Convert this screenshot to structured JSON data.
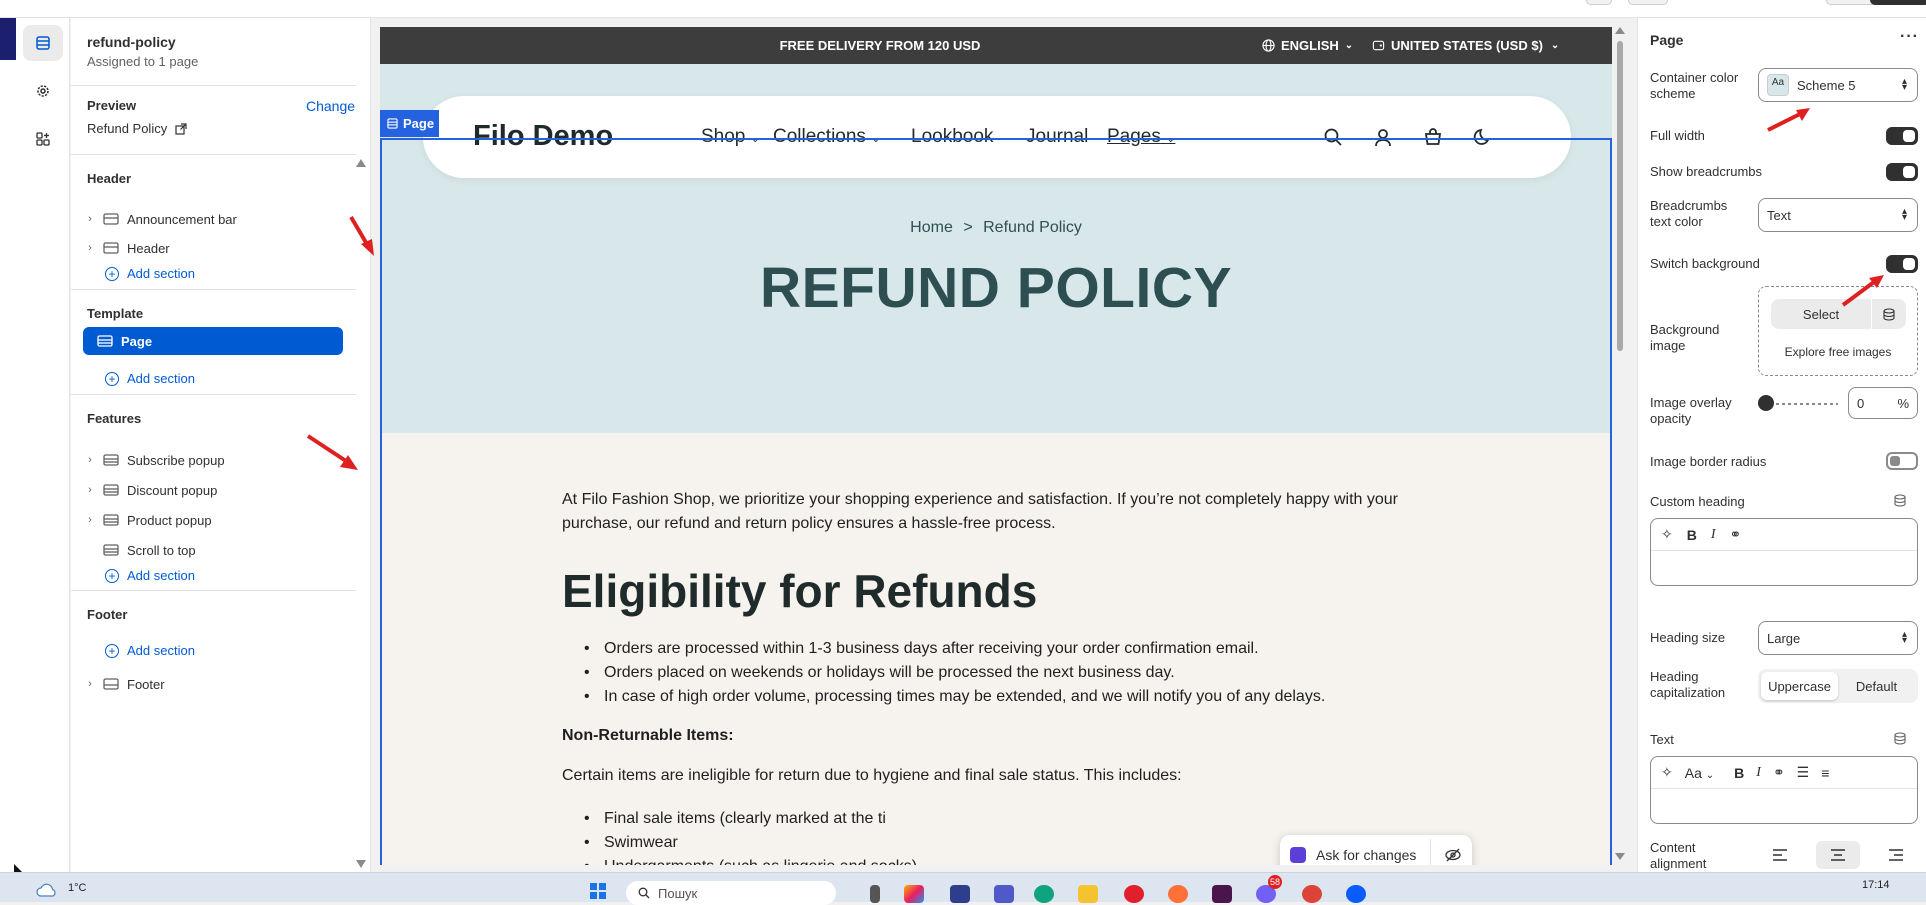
{
  "sidebar": {
    "title": "refund-policy",
    "subtitle": "Assigned to 1 page",
    "preview_label": "Preview",
    "change_label": "Change",
    "preview_page": "Refund Policy",
    "groups": {
      "header": {
        "label": "Header",
        "items": [
          "Announcement bar",
          "Header"
        ],
        "add": "Add section"
      },
      "template": {
        "label": "Template",
        "items": [
          "Page"
        ],
        "add": "Add section"
      },
      "features": {
        "label": "Features",
        "items": [
          "Subscribe popup",
          "Discount popup",
          "Product popup",
          "Scroll to top"
        ],
        "add": "Add section"
      },
      "footer": {
        "label": "Footer",
        "add": "Add section",
        "items": [
          "Footer"
        ]
      }
    }
  },
  "preview": {
    "page_tag": "Page",
    "announcement": {
      "text": "FREE DELIVERY FROM 120 USD",
      "language": "ENGLISH",
      "currency": "UNITED STATES (USD $)"
    },
    "nav": {
      "logo": "Filo Demo",
      "links": [
        "Shop",
        "Collections",
        "Lookbook",
        "Journal",
        "Pages"
      ]
    },
    "breadcrumb": {
      "home": "Home",
      "sep": ">",
      "current": "Refund Policy"
    },
    "title": "REFUND POLICY",
    "intro": "At Filo Fashion Shop, we prioritize your shopping experience and satisfaction. If you’re not completely happy with your purchase, our refund and return policy ensures a hassle-free process.",
    "heading": "Eligibility for Refunds",
    "bullets1": [
      "Orders are processed within 1-3 business days after receiving your order confirmation email.",
      "Orders placed on weekends or holidays will be processed the next business day.",
      "In case of high order volume, processing times may be extended, and we will notify you of any delays."
    ],
    "non_returnable_heading": "Non-Returnable Items:",
    "non_returnable_text": "Certain items are ineligible for return due to hygiene and final sale status. This includes:",
    "bullets2": [
      "Final sale items (clearly marked at the ti",
      "Swimwear",
      "Undergarments (such as lingerie and socks)"
    ],
    "ask_label": "Ask for changes"
  },
  "settings": {
    "title": "Page",
    "container_color_scheme_label": "Container color scheme",
    "container_color_scheme_value": "Scheme 5",
    "scheme_swatch_text": "Aa",
    "full_width_label": "Full width",
    "show_breadcrumbs_label": "Show breadcrumbs",
    "breadcrumbs_color_label": "Breadcrumbs text color",
    "breadcrumbs_color_value": "Text",
    "switch_background_label": "Switch background",
    "background_image_label": "Background image",
    "select_label": "Select",
    "explore_label": "Explore free images",
    "overlay_label": "Image overlay opacity",
    "overlay_value": "0",
    "overlay_unit": "%",
    "border_radius_label": "Image border radius",
    "custom_heading_label": "Custom heading",
    "heading_size_label": "Heading size",
    "heading_size_value": "Large",
    "heading_cap_label": "Heading capitalization",
    "cap_options": [
      "Uppercase",
      "Default"
    ],
    "text_label": "Text",
    "rte_font": "Aa",
    "content_alignment_label": "Content alignment"
  },
  "taskbar": {
    "weather_temp": "1°C",
    "search_placeholder": "Пошук",
    "badge_count": "58",
    "time": "17:14"
  },
  "colors": {
    "accent": "#005bd3",
    "selection": "#2462e0",
    "hero_bg": "#d8e7ea",
    "content_bg": "#f6f3ee",
    "title_color": "#2d4f52",
    "announcement_bg": "#3d3d3d"
  }
}
